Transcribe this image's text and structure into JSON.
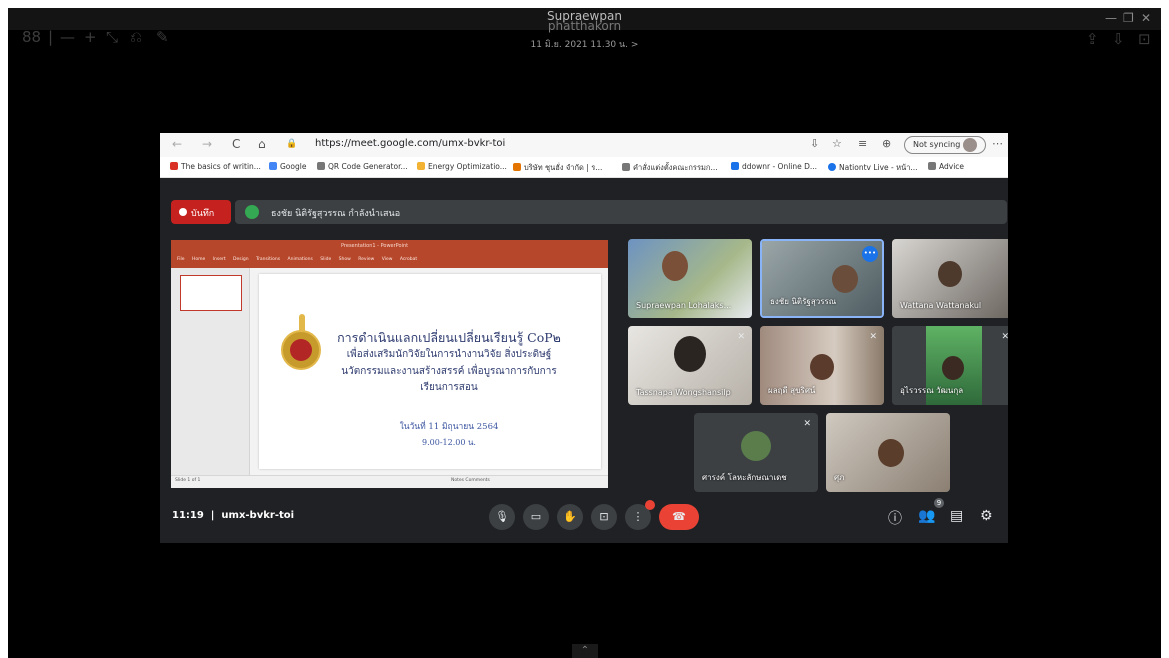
{
  "viewer": {
    "title": "Supraewpan",
    "title_line2": "phatthakorn",
    "date": "11 มิ.ย. 2021 11.30 น. >",
    "tools": [
      "88",
      "|",
      "—",
      "+",
      "⤡",
      "⎌",
      "✎"
    ],
    "right_tools": [
      "⇪",
      "⇩",
      "⊡"
    ],
    "window_controls": [
      "—",
      "❐",
      "✕"
    ]
  },
  "browser": {
    "back": "←",
    "forward": "→",
    "reload": "C",
    "home": "⌂",
    "lock": "🔒",
    "url": "https://meet.google.com/umx-bvkr-toi",
    "sync_label": "Not syncing",
    "bookmarks": [
      {
        "label": "The basics of writin...",
        "color": "#d93025"
      },
      {
        "label": "Google",
        "color": "#4285f4"
      },
      {
        "label": "QR Code Generator...",
        "color": "#777777"
      },
      {
        "label": "Energy Optimizatio...",
        "color": "#f2b233"
      },
      {
        "label": "บริษัท ชุนฮั่ง จำกัด | ร...",
        "color": "#e37400"
      },
      {
        "label": "คำสั่งแต่งตั้งคณะกรรมก...",
        "color": "#777777"
      },
      {
        "label": "ddownr - Online D...",
        "color": "#1a73e8"
      },
      {
        "label": "Nationtv Live - หน้า...",
        "color": "#1a73e8"
      },
      {
        "label": "Advice",
        "color": "#777777"
      }
    ]
  },
  "meet": {
    "record_label": "บันทึก",
    "presenter_text": "ธงชัย นิติรัฐสุวรรณ กำลังนำเสนอ",
    "slide": {
      "ribbon_title": "Presentation1 - PowerPoint",
      "ribbon_tabs": "File Home Insert Design Transitions Animations Slide Show Review View Acrobat",
      "line1": "การดำเนินแลกเปลี่ยนเปลี่ยนเรียนรู้ CoP๒",
      "line2": "เพื่อส่งเสริมนักวิจัยในการนำงานวิจัย สิ่งประดิษฐ์",
      "line3": "นวัตกรรมและงานสร้างสรรค์ เพื่อบูรณาการกับการ",
      "line4": "เรียนการสอน",
      "line5": "ในวันที่ 11 มิถุนายน 2564",
      "line6": "9.00-12.00 น.",
      "status_left": "Slide 1 of 1",
      "status_right": "Notes  Comments"
    },
    "participants": [
      {
        "name": "Supraewpan Lohalaks...",
        "muted": false,
        "color": "#5a7fa8"
      },
      {
        "name": "ธงชัย นิติรัฐสุวรรณ",
        "muted": false,
        "color": "#5f6f73"
      },
      {
        "name": "Wattana Wattanakul",
        "muted": false,
        "color": "#6b6258"
      },
      {
        "name": "Tassnapa Wongshansilp",
        "muted": true,
        "color": "#4f5659"
      },
      {
        "name": "ผลฤดี สุขริศน์",
        "muted": true,
        "color": "#7b675a"
      },
      {
        "name": "อุไรวรรณ วัฒนกุล",
        "muted": true,
        "color": "#4a6a4e"
      },
      {
        "name": "ศารงค์ โลหะลักษณาเดช",
        "muted": true,
        "color": "#3c4043"
      },
      {
        "name": "ศุภ",
        "muted": false,
        "color": "#777067"
      }
    ],
    "time": "11:19",
    "meeting_code": "umx-bvkr-toi",
    "controls": {
      "mic": "🎙",
      "camera": "▭",
      "hand": "✋",
      "present": "⊡",
      "more": "⋮",
      "end": "☎"
    },
    "right_controls": {
      "info": "ⓘ",
      "people": "👥",
      "chat": "▤",
      "activities": "⚙"
    },
    "people_count": "9"
  },
  "expander": "⌃"
}
